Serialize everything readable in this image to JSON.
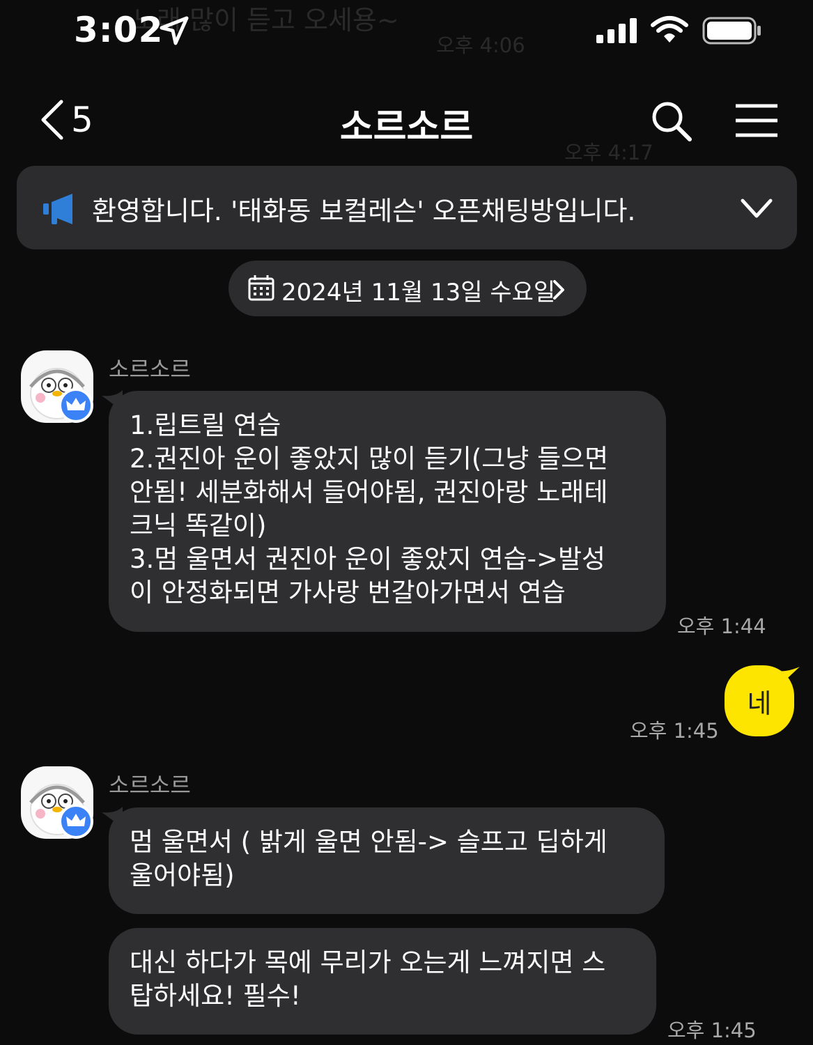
{
  "status_bar": {
    "time": "3:02"
  },
  "background_ghost": {
    "top_text": "노래 많이 듣고 오세용~",
    "top_time": "오후 4:06",
    "mid_time": "오후 4:17"
  },
  "header": {
    "back_count": "5",
    "title": "소르소르"
  },
  "notice": {
    "text": "환영합니다. '태화동 보컬레슨' 오픈채팅방입니다."
  },
  "date_divider": {
    "text": "2024년 11월 13일 수요일"
  },
  "messages": [
    {
      "sender": "소르소르",
      "lines": [
        "1.립트릴 연습",
        "2.권진아 운이 좋았지 많이 듣기(그냥 들으면",
        "안됨! 세분화해서 들어야됨, 권진아랑 노래테",
        "크닉 똑같이)",
        "3.멈 울면서 권진아 운이 좋았지 연습->발성",
        "이 안정화되면 가사랑 번갈아가면서 연습"
      ],
      "time": "오후 1:44"
    },
    {
      "mine": true,
      "text": "네",
      "time": "오후 1:45"
    },
    {
      "sender": "소르소르",
      "lines": [
        "멈 울면서 ( 밝게 울면 안됨-> 슬프고 딥하게",
        "울어야됨)"
      ]
    },
    {
      "lines": [
        "대신 하다가 목에 무리가 오는게 느껴지면 스",
        "탑하세요! 필수!"
      ],
      "time": "오후 1:45"
    }
  ],
  "colors": {
    "background": "#0c0c0c",
    "bubble_other": "#2f2f31",
    "bubble_mine": "#fee500",
    "badge": "#3b82f6",
    "megaphone": "#2f7fd8"
  }
}
